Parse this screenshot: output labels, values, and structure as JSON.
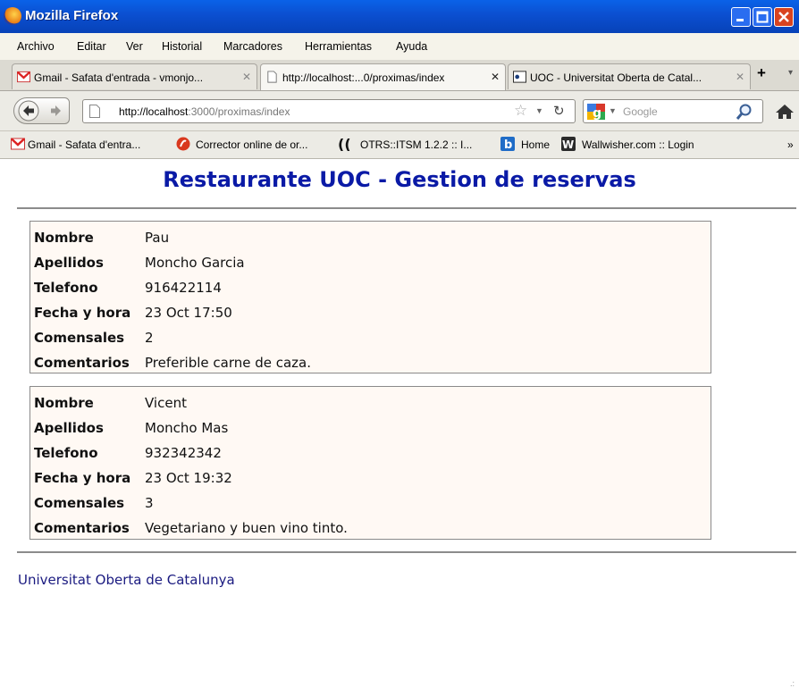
{
  "window": {
    "title": "Mozilla Firefox"
  },
  "menu": [
    "Archivo",
    "Editar",
    "Ver",
    "Historial",
    "Marcadores",
    "Herramientas",
    "Ayuda"
  ],
  "tabs": [
    {
      "label": "Gmail - Safata d'entrada - vmonjo...",
      "icon": "gmail-icon",
      "active": false
    },
    {
      "label": "http://localhost:...0/proximas/index",
      "icon": "page-icon",
      "active": true
    },
    {
      "label": "UOC - Universitat Oberta de Catal...",
      "icon": "uoc-icon",
      "active": false
    }
  ],
  "nav": {
    "url_host": "http://localhost",
    "url_rest": ":3000/proximas/index",
    "search_placeholder": "Google"
  },
  "bookmarks": [
    {
      "label": "Gmail - Safata d'entra...",
      "icon": "gmail-icon"
    },
    {
      "label": "Corrector online de or...",
      "icon": "spellcheck-icon"
    },
    {
      "label": "OTRS::ITSM 1.2.2 :: I...",
      "icon": "otrs-icon"
    },
    {
      "label": "Home",
      "icon": "b-icon"
    },
    {
      "label": "Wallwisher.com :: Login",
      "icon": "w-icon"
    }
  ],
  "page": {
    "title": "Restaurante UOC - Gestion de reservas",
    "field_labels": {
      "nombre": "Nombre",
      "apellidos": "Apellidos",
      "telefono": "Telefono",
      "fecha": "Fecha y hora",
      "comensales": "Comensales",
      "comentarios": "Comentarios"
    },
    "reservations": [
      {
        "nombre": "Pau",
        "apellidos": "Moncho Garcia",
        "telefono": "916422114",
        "fecha": "23 Oct 17:50",
        "comensales": "2",
        "comentarios": "Preferible carne de caza."
      },
      {
        "nombre": "Vicent",
        "apellidos": "Moncho Mas",
        "telefono": "932342342",
        "fecha": "23 Oct 19:32",
        "comensales": "3",
        "comentarios": "Vegetariano y buen vino tinto."
      }
    ],
    "footer": "Universitat Oberta de Catalunya"
  }
}
